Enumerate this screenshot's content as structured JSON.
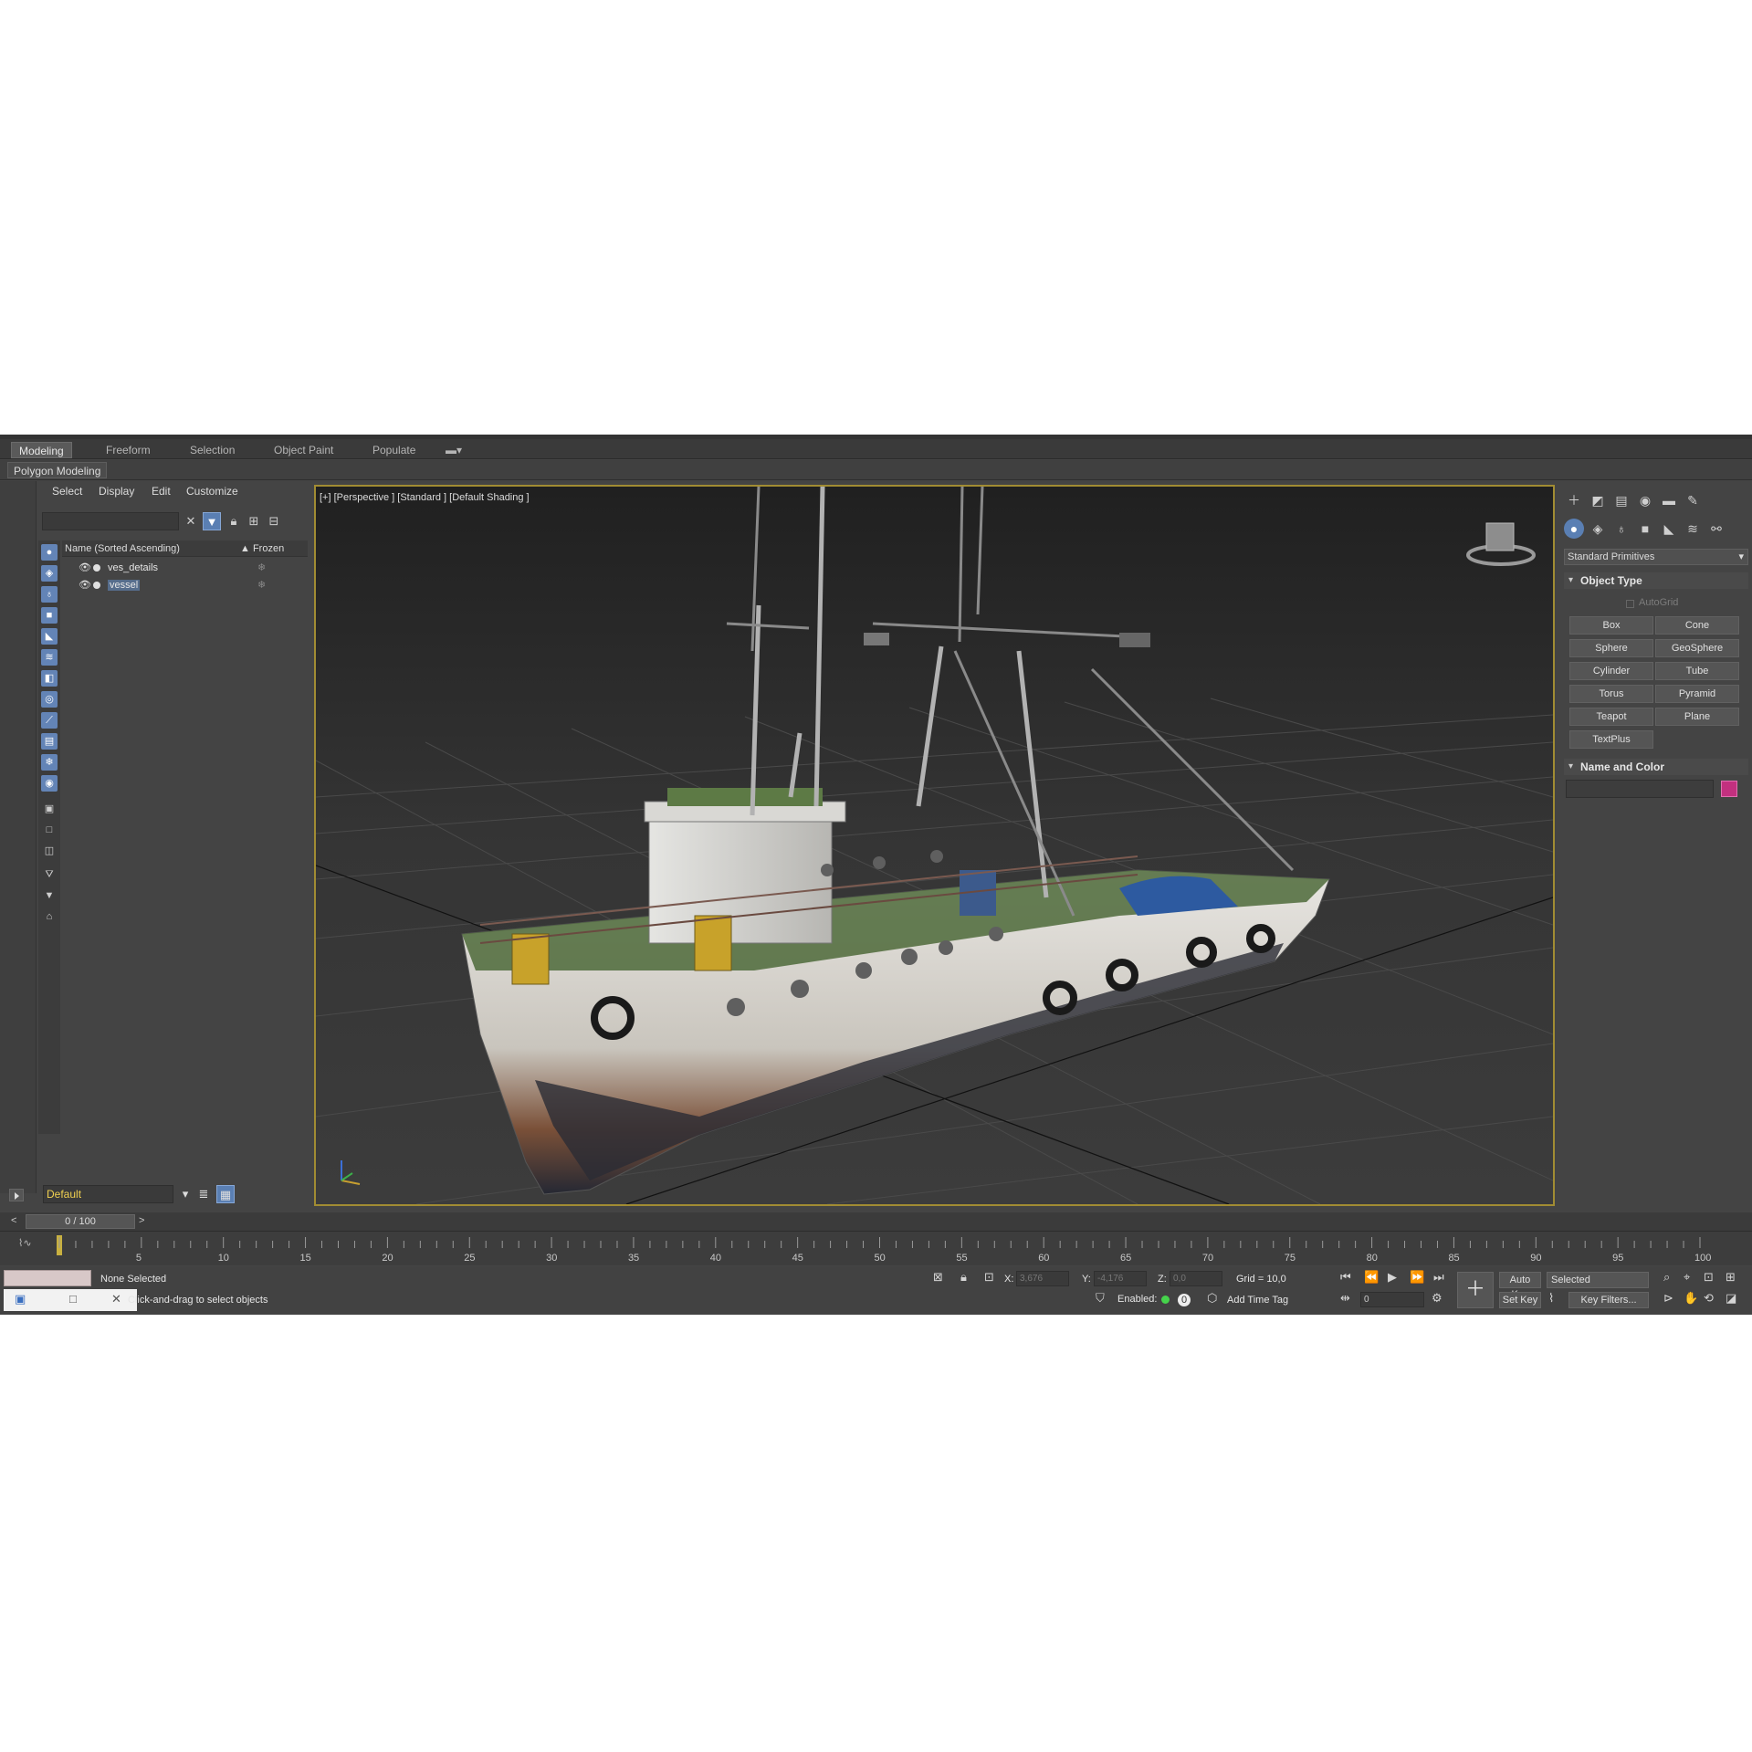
{
  "ribbon": {
    "tabs": [
      "Modeling",
      "Freeform",
      "Selection",
      "Object Paint",
      "Populate"
    ],
    "sub_label": "Polygon Modeling"
  },
  "scene_explorer": {
    "menu": [
      "Select",
      "Display",
      "Edit",
      "Customize"
    ],
    "column_name": "Name (Sorted Ascending)",
    "column_frozen": "Frozen",
    "sort_arrow": "▲",
    "rows": [
      {
        "name": "ves_details"
      },
      {
        "name": "vessel"
      }
    ],
    "layer": "Default"
  },
  "viewport": {
    "label": "[+] [Perspective ] [Standard ] [Default Shading ]",
    "grid_color": "#4a4a4a",
    "border_color": "#a18c33"
  },
  "command_panel": {
    "dropdown": "Standard Primitives",
    "object_type_title": "Object Type",
    "autogrid": "AutoGrid",
    "primitives": [
      "Box",
      "Cone",
      "Sphere",
      "GeoSphere",
      "Cylinder",
      "Tube",
      "Torus",
      "Pyramid",
      "Teapot",
      "Plane",
      "TextPlus"
    ],
    "name_color_title": "Name and Color",
    "object_color": "#c2307f"
  },
  "timeline": {
    "slider": "0 / 100",
    "prev": "<",
    "next": ">",
    "ticks": [
      "5",
      "10",
      "15",
      "20",
      "25",
      "30",
      "35",
      "40",
      "45",
      "50",
      "55",
      "60",
      "65",
      "70",
      "75",
      "80",
      "85",
      "90",
      "95",
      "100"
    ]
  },
  "status": {
    "selection": "None Selected",
    "prompt": "Click-and-drag to select objects",
    "x_label": "X:",
    "x_value": "3,676",
    "y_label": "Y:",
    "y_value": "-4,176",
    "z_label": "Z:",
    "z_value": "0,0",
    "grid": "Grid = 10,0",
    "enabled": "Enabled:",
    "enabled_count": "0",
    "add_time_tag": "Add Time Tag",
    "auto_key": "Auto Key",
    "set_key": "Set Key",
    "key_mode": "Selected",
    "key_filters": "Key Filters...",
    "frame": "0"
  }
}
